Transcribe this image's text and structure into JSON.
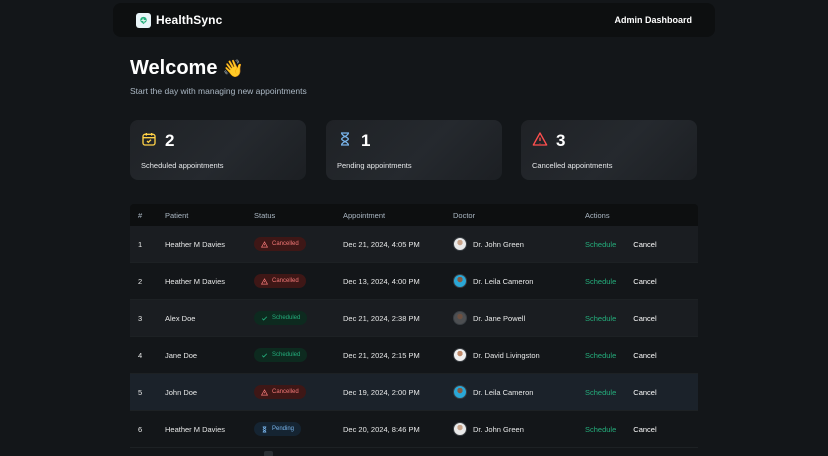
{
  "brand": {
    "name": "HealthSync",
    "logo_icon": "healthsync-logo-icon"
  },
  "nav": {
    "admin_label": "Admin Dashboard"
  },
  "welcome": {
    "title": "Welcome",
    "emoji": "👋",
    "subtitle": "Start the day with managing new appointments"
  },
  "stats": [
    {
      "count": "2",
      "label": "Scheduled appointments",
      "icon": "calendar-icon",
      "color": "#ffd147"
    },
    {
      "count": "1",
      "label": "Pending appointments",
      "icon": "hourglass-icon",
      "color": "#79b5ec"
    },
    {
      "count": "3",
      "label": "Cancelled appointments",
      "icon": "warning-icon",
      "color": "#ff4f4e"
    }
  ],
  "table": {
    "headers": [
      "#",
      "Patient",
      "Status",
      "Appointment",
      "Doctor",
      "Actions"
    ],
    "rows": [
      {
        "num": "1",
        "patient": "Heather M Davies",
        "status": "Cancelled",
        "date": "Dec 21, 2024, 4:05 PM",
        "doctor": "Dr. John Green",
        "schedule": "Schedule",
        "cancel": "Cancel"
      },
      {
        "num": "2",
        "patient": "Heather M Davies",
        "status": "Cancelled",
        "date": "Dec 13, 2024, 4:00 PM",
        "doctor": "Dr. Leila Cameron",
        "schedule": "Schedule",
        "cancel": "Cancel"
      },
      {
        "num": "3",
        "patient": "Alex Doe",
        "status": "Scheduled",
        "date": "Dec 21, 2024, 2:38 PM",
        "doctor": "Dr. Jane Powell",
        "schedule": "Schedule",
        "cancel": "Cancel"
      },
      {
        "num": "4",
        "patient": "Jane Doe",
        "status": "Scheduled",
        "date": "Dec 21, 2024, 2:15 PM",
        "doctor": "Dr. David Livingston",
        "schedule": "Schedule",
        "cancel": "Cancel"
      },
      {
        "num": "5",
        "patient": "John Doe",
        "status": "Cancelled",
        "date": "Dec 19, 2024, 2:00 PM",
        "doctor": "Dr. Leila Cameron",
        "schedule": "Schedule",
        "cancel": "Cancel"
      },
      {
        "num": "6",
        "patient": "Heather M Davies",
        "status": "Pending",
        "date": "Dec 20, 2024, 8:46 PM",
        "doctor": "Dr. John Green",
        "schedule": "Schedule",
        "cancel": "Cancel"
      }
    ]
  },
  "colors": {
    "background": "#131619",
    "accent_green": "#24ae7c",
    "cancelled_red": "#f37877",
    "pending_blue": "#79b5ec",
    "scheduled_yellow": "#ffd147"
  }
}
